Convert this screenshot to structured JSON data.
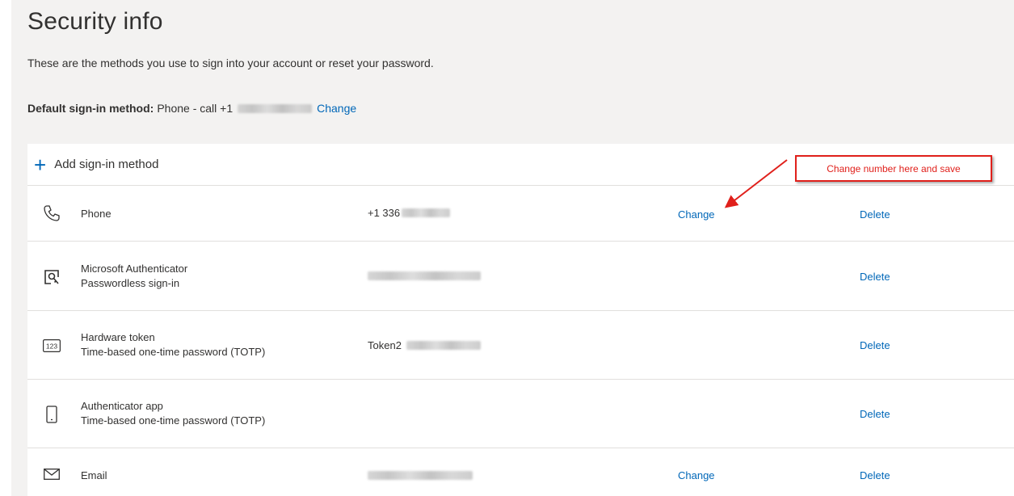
{
  "page": {
    "title": "Security info",
    "subtitle": "These are the methods you use to sign into your account or reset your password.",
    "default_label": "Default sign-in method:",
    "default_value": "Phone - call +1",
    "default_change": "Change"
  },
  "add_method": {
    "label": "Add sign-in method"
  },
  "methods": [
    {
      "name": "Phone",
      "subname": "",
      "detail": "+1 336",
      "change": "Change",
      "delete": "Delete",
      "icon": "phone-icon"
    },
    {
      "name": "Microsoft Authenticator",
      "subname": "Passwordless sign-in",
      "detail": "",
      "change": "",
      "delete": "Delete",
      "icon": "authenticator-icon"
    },
    {
      "name": "Hardware token",
      "subname": "Time-based one-time password (TOTP)",
      "detail": "Token2",
      "change": "",
      "delete": "Delete",
      "icon": "hardware-token-icon"
    },
    {
      "name": "Authenticator app",
      "subname": "Time-based one-time password (TOTP)",
      "detail": "",
      "change": "",
      "delete": "Delete",
      "icon": "mobile-device-icon"
    },
    {
      "name": "Email",
      "subname": "",
      "detail": "",
      "change": "Change",
      "delete": "Delete",
      "icon": "envelope-icon"
    }
  ],
  "annotation": {
    "text": "Change number here and save",
    "color": "#e0201b"
  },
  "colors": {
    "link": "#0067b8",
    "background": "#f3f2f1",
    "card": "#ffffff"
  }
}
